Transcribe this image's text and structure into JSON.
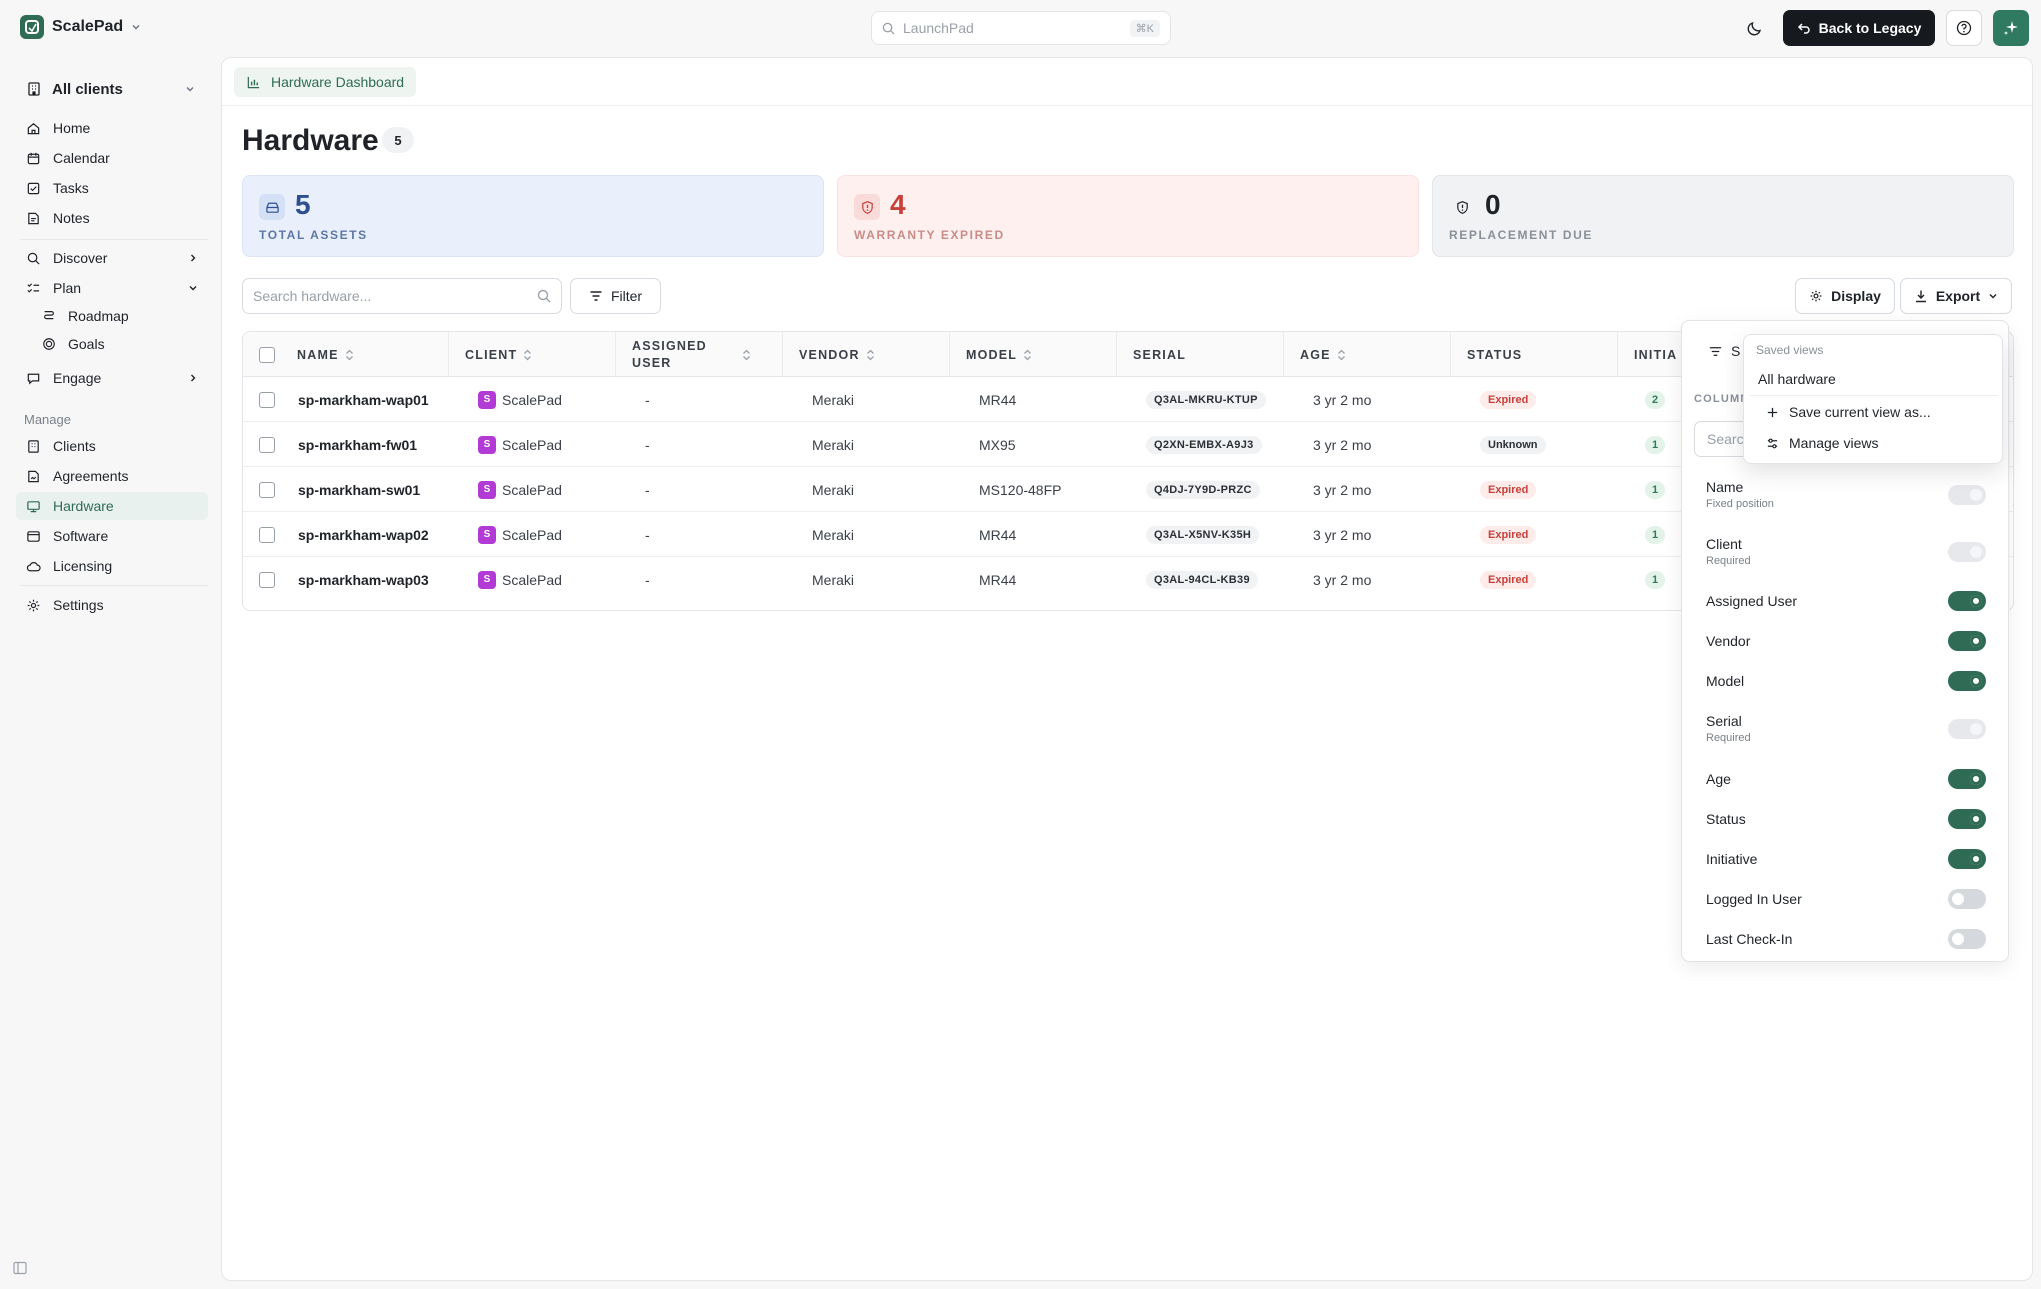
{
  "app": {
    "brand": "ScalePad",
    "launchpad_placeholder": "LaunchPad",
    "launchpad_shortcut": "⌘K",
    "back_to_legacy": "Back to Legacy",
    "accent": "#2f6b55"
  },
  "sidebar": {
    "client_selector": "All clients",
    "items": [
      {
        "label": "Home",
        "icon": "home-icon"
      },
      {
        "label": "Calendar",
        "icon": "calendar-icon"
      },
      {
        "label": "Tasks",
        "icon": "tasks-icon"
      },
      {
        "label": "Notes",
        "icon": "notes-icon"
      },
      {
        "label": "Discover",
        "icon": "search-icon"
      },
      {
        "label": "Plan",
        "icon": "plan-icon"
      },
      {
        "label": "Roadmap",
        "icon": "roadmap-icon"
      },
      {
        "label": "Goals",
        "icon": "goals-icon"
      },
      {
        "label": "Engage",
        "icon": "engage-icon"
      }
    ],
    "manage_section": "Manage",
    "manage_items": [
      {
        "label": "Clients",
        "icon": "clients-icon"
      },
      {
        "label": "Agreements",
        "icon": "agreements-icon"
      },
      {
        "label": "Hardware",
        "icon": "hardware-icon",
        "active": true
      },
      {
        "label": "Software",
        "icon": "software-icon"
      },
      {
        "label": "Licensing",
        "icon": "cloud-icon"
      }
    ],
    "settings": "Settings"
  },
  "main": {
    "breadcrumb": "Hardware Dashboard",
    "title": "Hardware",
    "count": "5",
    "stats": [
      {
        "value": "5",
        "label": "TOTAL ASSETS"
      },
      {
        "value": "4",
        "label": "WARRANTY EXPIRED"
      },
      {
        "value": "0",
        "label": "REPLACEMENT DUE"
      }
    ],
    "search_placeholder": "Search hardware...",
    "filter_label": "Filter",
    "display_label": "Display",
    "export_label": "Export"
  },
  "table": {
    "headers": [
      "NAME",
      "CLIENT",
      "ASSIGNED USER",
      "VENDOR",
      "MODEL",
      "SERIAL",
      "AGE",
      "STATUS",
      "INITIA"
    ],
    "header_assigned_1": "ASSIGNED",
    "header_assigned_2": "USER",
    "rows": [
      {
        "name": "sp-markham-wap01",
        "client_initial": "S",
        "client": "ScalePad",
        "user": "-",
        "vendor": "Meraki",
        "model": "MR44",
        "serial": "Q3AL-MKRU-KTUP",
        "age": "3 yr 2 mo",
        "status": "Expired",
        "initiative": "2"
      },
      {
        "name": "sp-markham-fw01",
        "client_initial": "S",
        "client": "ScalePad",
        "user": "-",
        "vendor": "Meraki",
        "model": "MX95",
        "serial": "Q2XN-EMBX-A9J3",
        "age": "3 yr 2 mo",
        "status": "Unknown",
        "initiative": "1"
      },
      {
        "name": "sp-markham-sw01",
        "client_initial": "S",
        "client": "ScalePad",
        "user": "-",
        "vendor": "Meraki",
        "model": "MS120-48FP",
        "serial": "Q4DJ-7Y9D-PRZC",
        "age": "3 yr 2 mo",
        "status": "Expired",
        "initiative": "1"
      },
      {
        "name": "sp-markham-wap02",
        "client_initial": "S",
        "client": "ScalePad",
        "user": "-",
        "vendor": "Meraki",
        "model": "MR44",
        "serial": "Q3AL-X5NV-K35H",
        "age": "3 yr 2 mo",
        "status": "Expired",
        "initiative": "1"
      },
      {
        "name": "sp-markham-wap03",
        "client_initial": "S",
        "client": "ScalePad",
        "user": "-",
        "vendor": "Meraki",
        "model": "MR44",
        "serial": "Q3AL-94CL-KB39",
        "age": "3 yr 2 mo",
        "status": "Expired",
        "initiative": "1"
      }
    ]
  },
  "display_panel": {
    "header_partial": "S",
    "columns_label": "COLUMN",
    "search_placeholder": "Searc",
    "columns": [
      {
        "name": "Name",
        "sub": "Fixed position",
        "state": "disabled"
      },
      {
        "name": "Client",
        "sub": "Required",
        "state": "disabled"
      },
      {
        "name": "Assigned User",
        "sub": "",
        "state": "on"
      },
      {
        "name": "Vendor",
        "sub": "",
        "state": "on"
      },
      {
        "name": "Model",
        "sub": "",
        "state": "on"
      },
      {
        "name": "Serial",
        "sub": "Required",
        "state": "disabled"
      },
      {
        "name": "Age",
        "sub": "",
        "state": "on"
      },
      {
        "name": "Status",
        "sub": "",
        "state": "on"
      },
      {
        "name": "Initiative",
        "sub": "",
        "state": "on"
      },
      {
        "name": "Logged In User",
        "sub": "",
        "state": "off"
      },
      {
        "name": "Last Check-In",
        "sub": "",
        "state": "off"
      }
    ]
  },
  "saved_views": {
    "label": "Saved views",
    "items": [
      "All hardware"
    ],
    "save_current": "Save current view as...",
    "manage": "Manage views"
  }
}
